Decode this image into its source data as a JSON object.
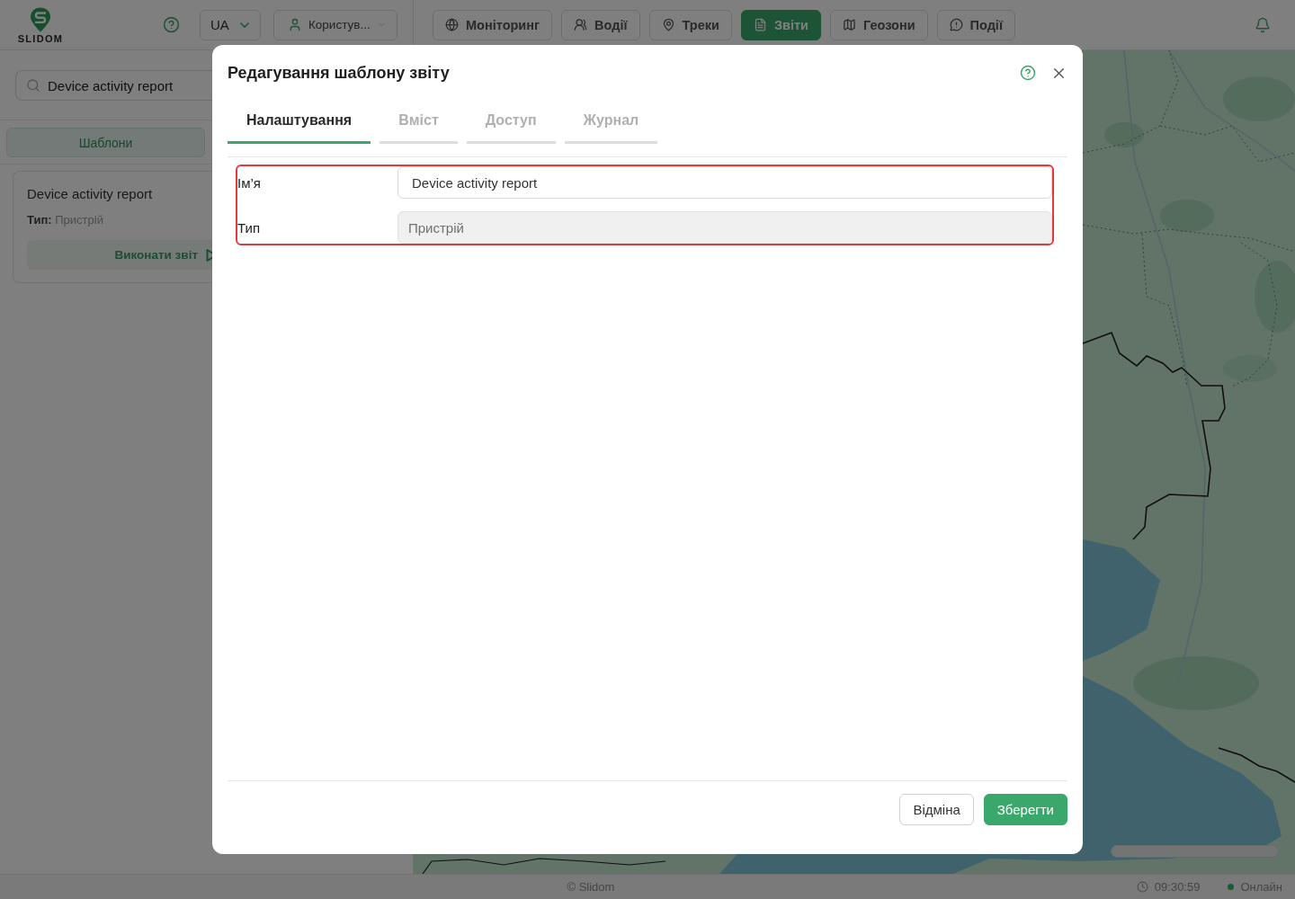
{
  "header": {
    "logo": "SLIDOM",
    "language": "UA",
    "user": "Користув...",
    "nav": [
      {
        "label": "Моніторинг",
        "selected": false
      },
      {
        "label": "Водії",
        "selected": false
      },
      {
        "label": "Треки",
        "selected": false
      },
      {
        "label": "Звіти",
        "selected": true
      },
      {
        "label": "Геозони",
        "selected": false
      },
      {
        "label": "Події",
        "selected": false
      }
    ]
  },
  "sidebar": {
    "search": {
      "value": "Device activity report"
    },
    "tabs": [
      {
        "label": "Шаблони",
        "selected": true
      }
    ],
    "templates": [
      {
        "title": "Device activity report",
        "type": "**Тип:** Пристрій",
        "action": "Виконати звіт"
      }
    ]
  },
  "modal": {
    "title": "Редагування шаблону звіту",
    "tabs": [
      {
        "label": "Налаштування",
        "selected": true
      },
      {
        "label": "Вміст",
        "selected": false
      },
      {
        "label": "Доступ",
        "selected": false
      },
      {
        "label": "Журнал",
        "selected": false
      }
    ],
    "form": {
      "highlighted": true,
      "fields": [
        {
          "label": "Ім’я",
          "value": "Device activity report",
          "disabled": false
        },
        {
          "label": "Тип",
          "value": "Пристрій",
          "disabled": true
        }
      ]
    },
    "buttons": [
      {
        "label": "Відміна",
        "kind": "secondary"
      },
      {
        "label": "Зберегти",
        "kind": "primary"
      }
    ]
  },
  "footer": {
    "copyright": "© Slidom",
    "time": "09:30:59",
    "status": {
      "label": "Онлайн",
      "online": true
    }
  }
}
